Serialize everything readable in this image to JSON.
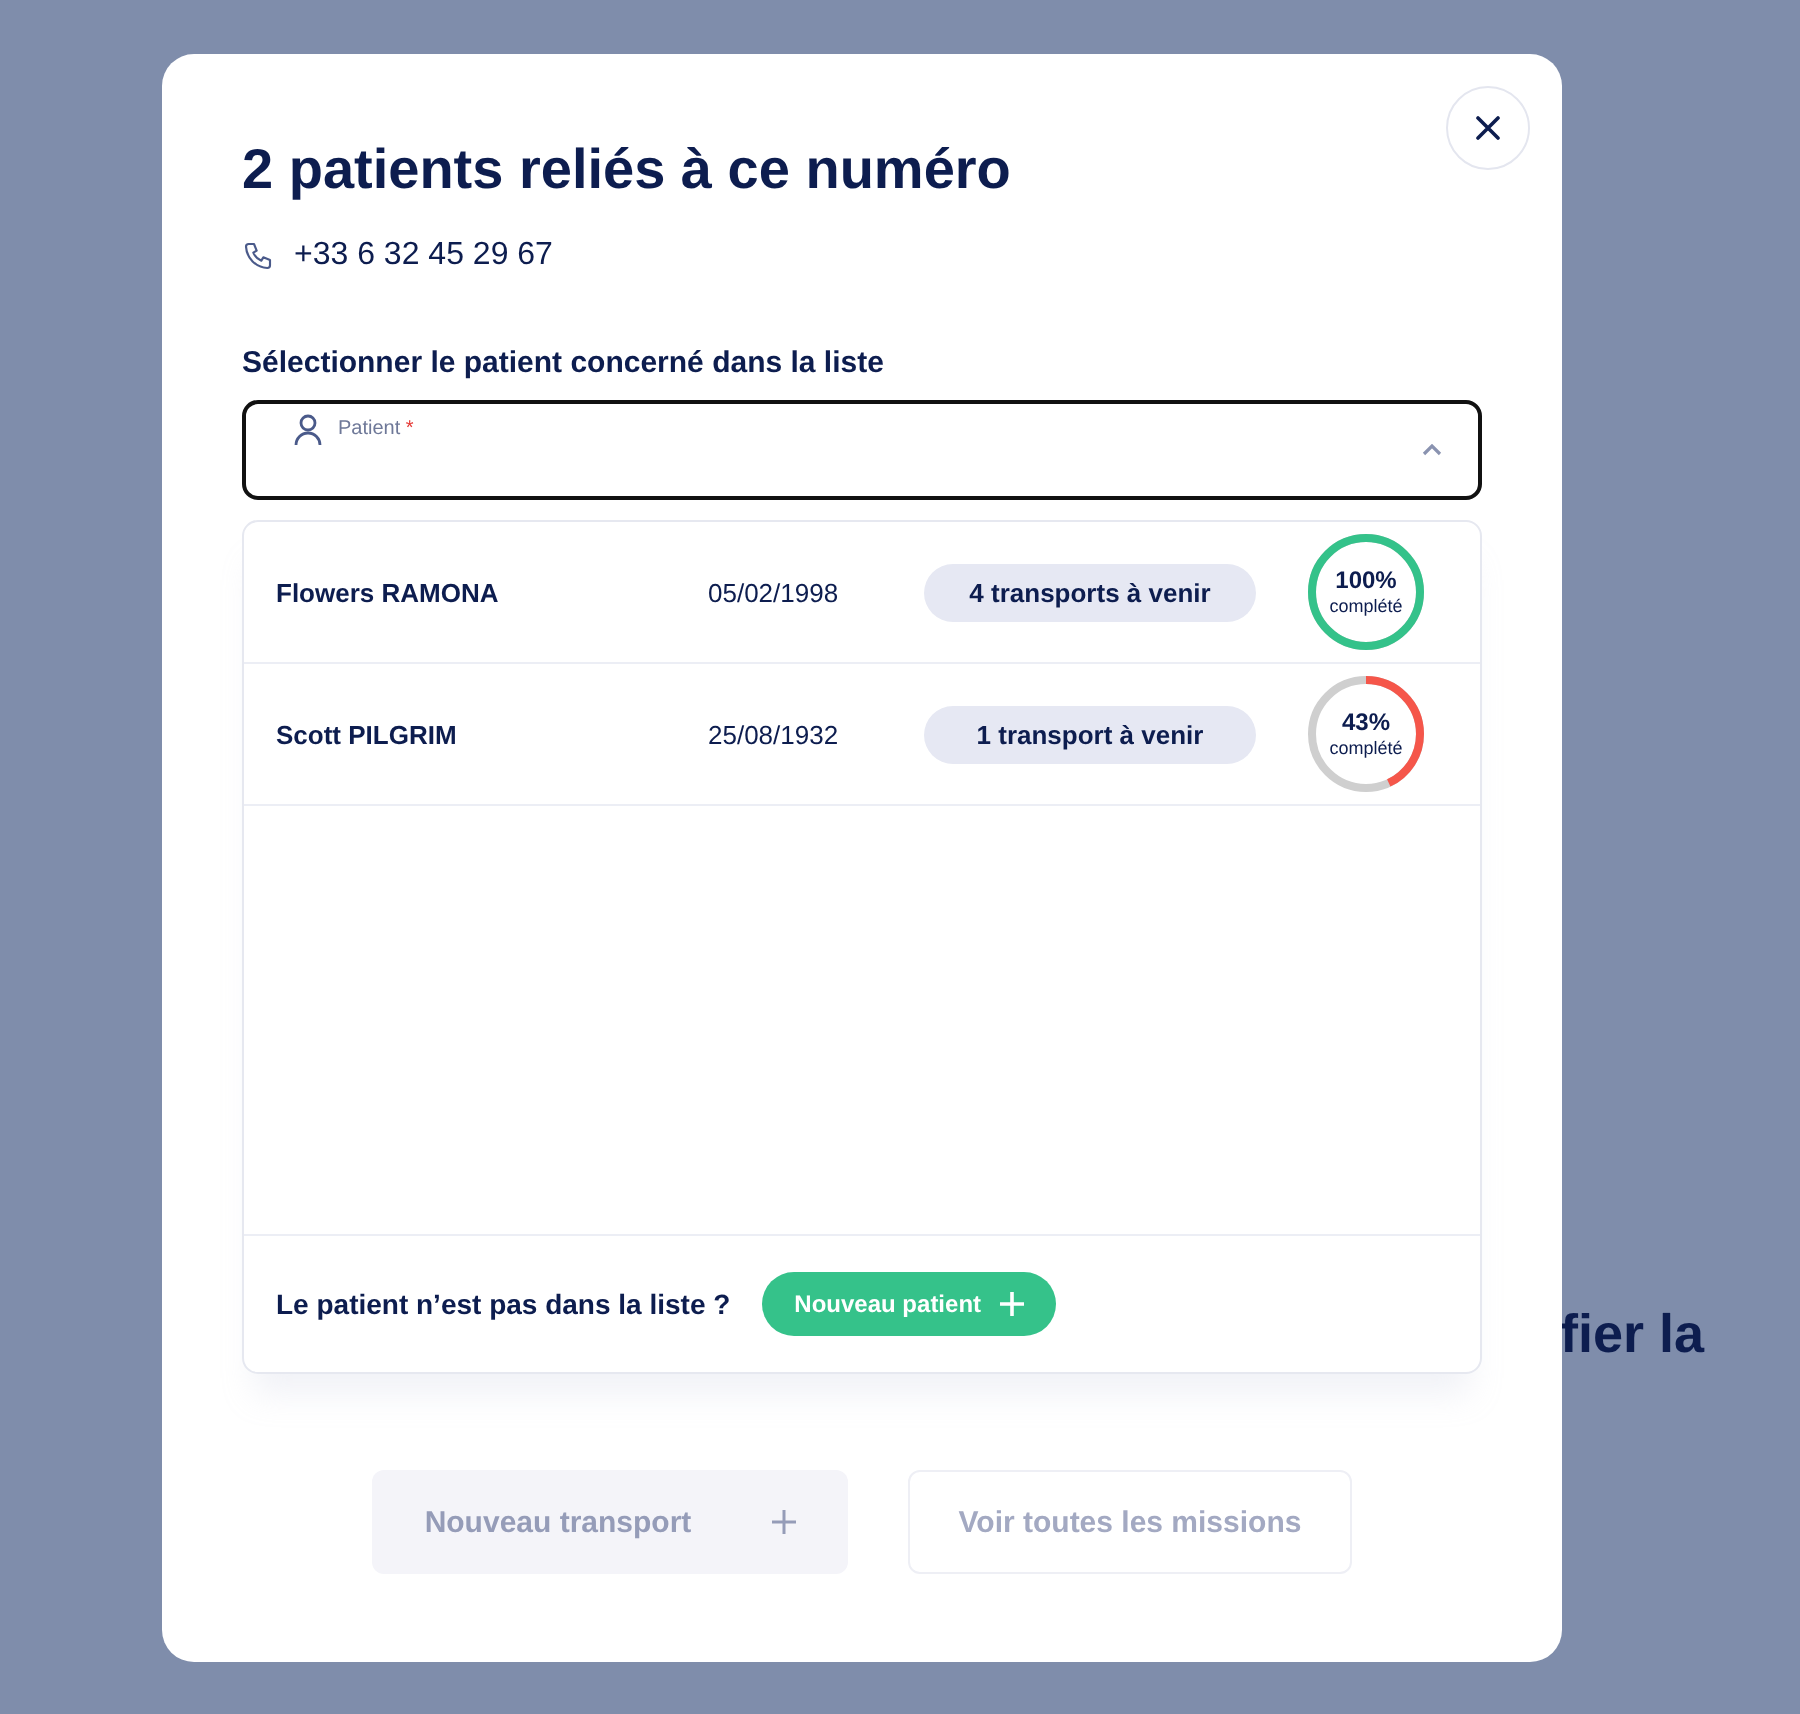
{
  "background_text": "fier la",
  "modal": {
    "title": "2 patients reliés à ce numéro",
    "phone": "+33 6 32 45 29 67",
    "select_label": "Sélectionner le patient concerné dans la liste",
    "field": {
      "label": "Patient",
      "required_mark": "*",
      "expanded": true
    },
    "patients": [
      {
        "name": "Flowers RAMONA",
        "birthdate": "05/02/1998",
        "transports": "4 transports à venir",
        "progress": "100%",
        "progress_label": "complété",
        "level": 1.0,
        "color": "#34c28a"
      },
      {
        "name": "Scott PILGRIM",
        "birthdate": "25/08/1932",
        "transports": "1 transport à venir",
        "progress": "43%",
        "progress_label": "complété",
        "level": 0.43,
        "color": "#f5564a"
      }
    ],
    "not_in_list": "Le patient n’est pas dans la liste ?",
    "new_patient_button": "Nouveau patient",
    "actions": [
      {
        "label": "Nouveau transport",
        "kind": "add",
        "disabled": true
      },
      {
        "label": "Voir toutes les missions",
        "kind": "outline",
        "disabled": true
      }
    ]
  }
}
